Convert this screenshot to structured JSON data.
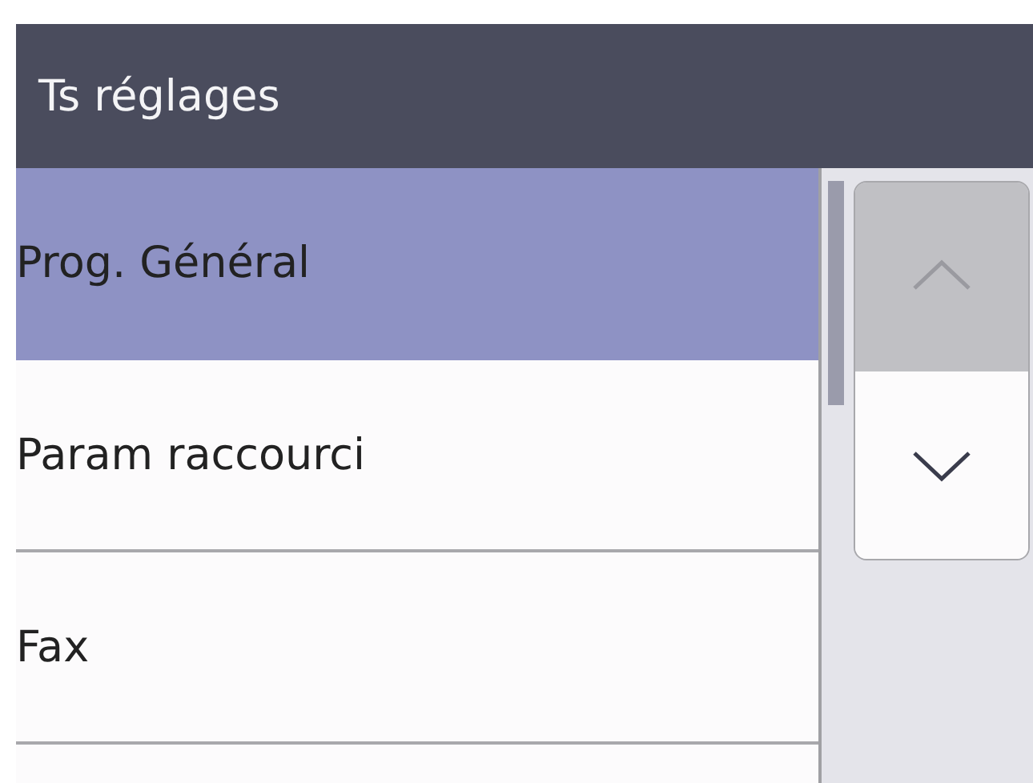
{
  "header": {
    "title": "Ts réglages"
  },
  "items": [
    {
      "label": "Prog. Général",
      "selected": true
    },
    {
      "label": "Param raccourci",
      "selected": false
    },
    {
      "label": "Fax",
      "selected": false
    }
  ],
  "scroll_buttons": {
    "up": {
      "disabled": true
    },
    "down": {
      "disabled": false
    }
  }
}
